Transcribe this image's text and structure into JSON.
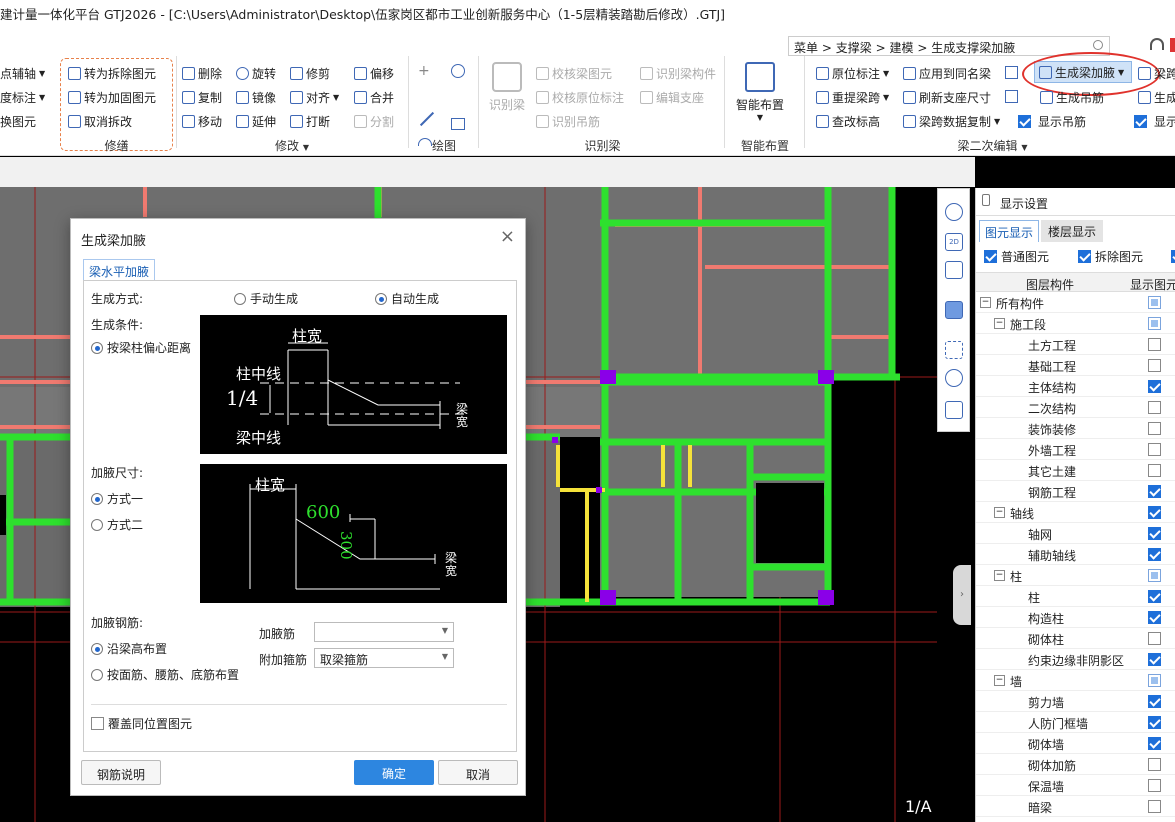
{
  "window": {
    "title": "建计量一体化平台 GTJ2026 - [C:\\Users\\Administrator\\Desktop\\伍家岗区都市工业创新服务中心（1-5层精装踏勘后修改）.GTJ]"
  },
  "breadcrumb": {
    "items": [
      "菜单",
      ">",
      "支撑梁",
      ">",
      "建模",
      ">",
      "生成支撑梁加腋"
    ]
  },
  "ribbon": {
    "left_partial": [
      "点辅轴",
      "度标注",
      "换图元"
    ],
    "xiubu": {
      "items": [
        "转为拆除图元",
        "转为加固图元",
        "取消拆改"
      ],
      "label": "修缮"
    },
    "modify": {
      "items": [
        "删除",
        "旋转",
        "修剪",
        "偏移",
        "复制",
        "镜像",
        "对齐",
        "合并",
        "移动",
        "延伸",
        "打断",
        "分割"
      ],
      "label": "修改"
    },
    "draw": {
      "label": "绘图"
    },
    "identify": {
      "main": "识别梁",
      "items": [
        "校核梁图元",
        "识别梁构件",
        "校核原位标注",
        "编辑支座",
        "识别吊筋"
      ],
      "label": "识别梁"
    },
    "smart": {
      "main": "智能布置",
      "label": "智能布置"
    },
    "secondary": {
      "items": [
        "原位标注",
        "应用到同名梁",
        "生成梁加腋",
        "梁跨",
        "重提梁跨",
        "刷新支座尺寸",
        "生成吊筋",
        "生成",
        "查改标高",
        "梁跨数据复制",
        "显示吊筋",
        "显示"
      ],
      "label": "梁二次编辑"
    }
  },
  "display_panel": {
    "title": "显示设置",
    "tabs": [
      "图元显示",
      "楼层显示"
    ],
    "checks": [
      "普通图元",
      "拆除图元"
    ],
    "columns": [
      "图层构件",
      "显示图元"
    ],
    "rows": [
      {
        "label": "所有构件",
        "level": 0,
        "exp": "−",
        "state": "part"
      },
      {
        "label": "施工段",
        "level": 1,
        "exp": "−",
        "state": "part"
      },
      {
        "label": "土方工程",
        "level": 2,
        "state": "off"
      },
      {
        "label": "基础工程",
        "level": 2,
        "state": "off"
      },
      {
        "label": "主体结构",
        "level": 2,
        "state": "on"
      },
      {
        "label": "二次结构",
        "level": 2,
        "state": "off"
      },
      {
        "label": "装饰装修",
        "level": 2,
        "state": "off"
      },
      {
        "label": "外墙工程",
        "level": 2,
        "state": "off"
      },
      {
        "label": "其它土建",
        "level": 2,
        "state": "off"
      },
      {
        "label": "钢筋工程",
        "level": 2,
        "state": "on"
      },
      {
        "label": "轴线",
        "level": 1,
        "exp": "−",
        "state": "on"
      },
      {
        "label": "轴网",
        "level": 2,
        "state": "on"
      },
      {
        "label": "辅助轴线",
        "level": 2,
        "state": "on"
      },
      {
        "label": "柱",
        "level": 1,
        "exp": "−",
        "state": "part"
      },
      {
        "label": "柱",
        "level": 2,
        "state": "on"
      },
      {
        "label": "构造柱",
        "level": 2,
        "state": "on"
      },
      {
        "label": "砌体柱",
        "level": 2,
        "state": "off"
      },
      {
        "label": "约束边缘非阴影区",
        "level": 2,
        "state": "on"
      },
      {
        "label": "墙",
        "level": 1,
        "exp": "−",
        "state": "part"
      },
      {
        "label": "剪力墙",
        "level": 2,
        "state": "on"
      },
      {
        "label": "人防门框墙",
        "level": 2,
        "state": "on"
      },
      {
        "label": "砌体墙",
        "level": 2,
        "state": "on"
      },
      {
        "label": "砌体加筋",
        "level": 2,
        "state": "off"
      },
      {
        "label": "保温墙",
        "level": 2,
        "state": "off"
      },
      {
        "label": "暗梁",
        "level": 2,
        "state": "off"
      }
    ]
  },
  "dialog": {
    "title": "生成梁加腋",
    "tab": "梁水平加腋",
    "method_label": "生成方式:",
    "method_manual": "手动生成",
    "method_auto": "自动生成",
    "cond_label": "生成条件:",
    "cond_option": "按梁柱偏心距离",
    "diagram1": {
      "col_width": "柱宽",
      "col_center": "柱中线",
      "ratio": "1/4",
      "beam_center": "梁中线",
      "beam_width": "梁宽"
    },
    "size_label": "加腋尺寸:",
    "size_opt1": "方式一",
    "size_opt2": "方式二",
    "diagram2": {
      "col_width": "柱宽",
      "dim_h": "600",
      "dim_v": "300",
      "beam_width": "梁宽"
    },
    "rebar_label": "加腋钢筋:",
    "rebar_opt1": "沿梁高布置",
    "rebar_opt2": "按面筋、腰筋、底筋布置",
    "haunch_bar_label": "加腋筋",
    "haunch_bar_value": "",
    "stirrup_label": "附加箍筋",
    "stirrup_value": "取梁箍筋",
    "overwrite": "覆盖同位置图元",
    "help_btn": "钢筋说明",
    "ok_btn": "确定",
    "cancel_btn": "取消"
  },
  "canvas": {
    "corner_text": "1/A"
  }
}
